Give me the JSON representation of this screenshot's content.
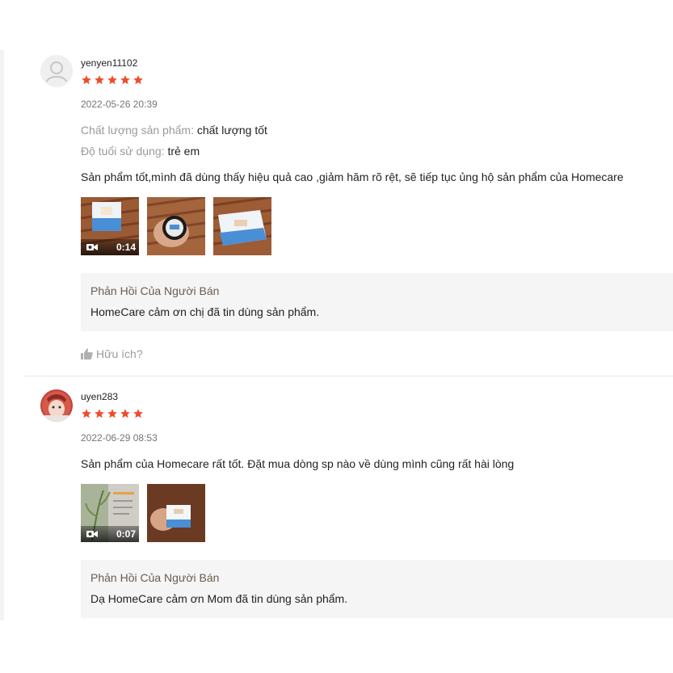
{
  "reviews": [
    {
      "username": "yenyen11102",
      "rating": 5,
      "date": "2022-05-26 20:39",
      "attributes": [
        {
          "label": "Chất lượng sản phẩm:",
          "value": "chất lượng tốt"
        },
        {
          "label": "Độ tuổi sử dụng:",
          "value": "trẻ em"
        }
      ],
      "comment": "Sản phẩm tốt,mình đã dùng thấy hiệu quả cao ,giảm hăm rõ rệt, sẽ tiếp tục ủng hộ sản phẩm của  Homecare",
      "media": [
        {
          "type": "video",
          "duration": "0:14"
        },
        {
          "type": "image"
        },
        {
          "type": "image"
        }
      ],
      "seller_reply": {
        "title": "Phản Hồi Của Người Bán",
        "text": "HomeCare cảm ơn chị đã tin dùng sản phẩm."
      },
      "helpful_label": "Hữu ích?"
    },
    {
      "username": "uyen283",
      "rating": 5,
      "date": "2022-06-29 08:53",
      "comment": "Sản phẩm của Homecare rất tốt. Đặt mua dòng sp nào về dùng mình cũng rất hài lòng",
      "media": [
        {
          "type": "video",
          "duration": "0:07"
        },
        {
          "type": "image"
        }
      ],
      "seller_reply": {
        "title": "Phản Hồi Của Người Bán",
        "text": "Dạ HomeCare cảm ơn Mom đã tin dùng sản phẩm."
      }
    }
  ],
  "colors": {
    "star": "#ee4d2d",
    "reply_background": "#f5f5f5",
    "muted_text": "#9a9a9a"
  },
  "icons": [
    "default-avatar-icon",
    "star-icon",
    "video-camera-icon",
    "thumbs-up-icon"
  ]
}
